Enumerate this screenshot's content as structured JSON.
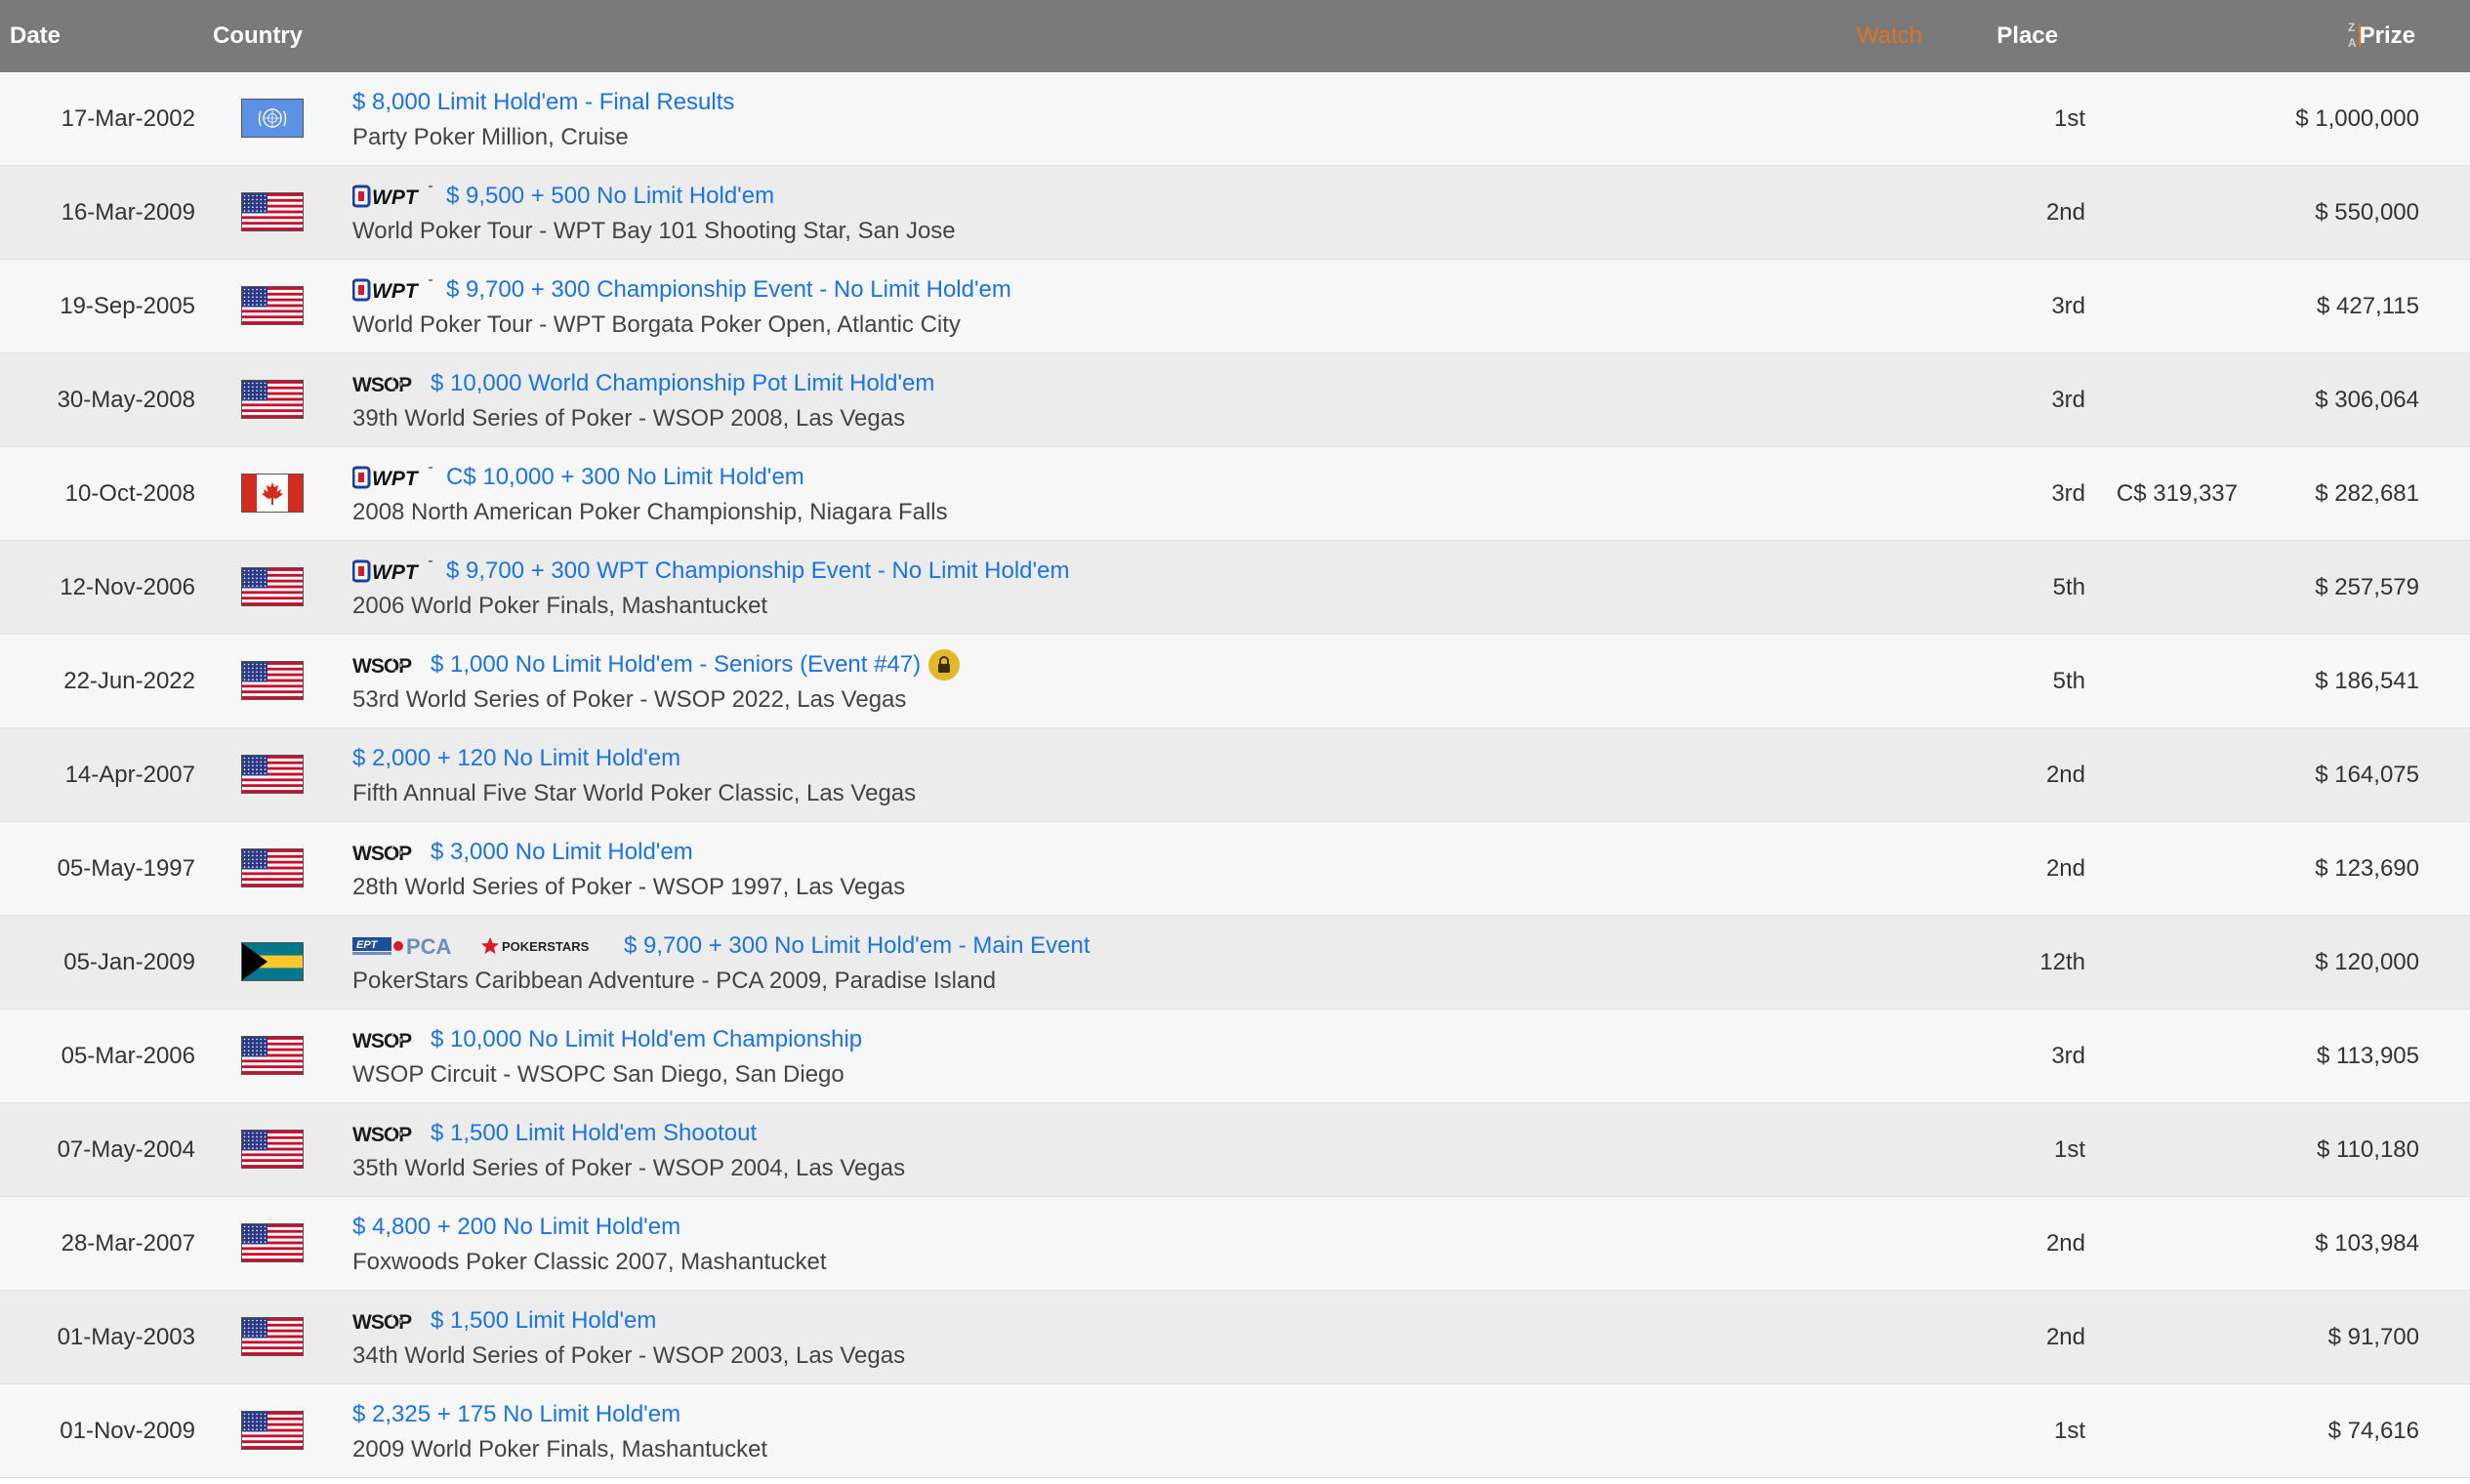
{
  "header": {
    "date": "Date",
    "country": "Country",
    "watch": "Watch",
    "place": "Place",
    "sort_icon": "sort-z-a-icon",
    "prize": "Prize"
  },
  "colors": {
    "header_bg": "#7a7a7a",
    "watch": "#e0731f",
    "link": "#1a73e8",
    "row_odd": "#f7f7f7",
    "row_even": "#ececec",
    "lock": "#e5b82a"
  },
  "rows": [
    {
      "date": "17-Mar-2002",
      "country": "un-flag",
      "logos": [],
      "title": "$ 8,000 Limit Hold'em - Final Results",
      "subtitle": "Party Poker Million, Cruise",
      "lock": false,
      "place": "1st",
      "local_prize": "",
      "prize": "$ 1,000,000"
    },
    {
      "date": "16-Mar-2009",
      "country": "us-flag",
      "logos": [
        "wpt-logo"
      ],
      "title": "$ 9,500 + 500 No Limit Hold'em",
      "subtitle": "World Poker Tour - WPT Bay 101 Shooting Star, San Jose",
      "lock": false,
      "place": "2nd",
      "local_prize": "",
      "prize": "$ 550,000"
    },
    {
      "date": "19-Sep-2005",
      "country": "us-flag",
      "logos": [
        "wpt-logo"
      ],
      "title": "$ 9,700 + 300 Championship Event - No Limit Hold'em",
      "subtitle": "World Poker Tour - WPT Borgata Poker Open, Atlantic City",
      "lock": false,
      "place": "3rd",
      "local_prize": "",
      "prize": "$ 427,115"
    },
    {
      "date": "30-May-2008",
      "country": "us-flag",
      "logos": [
        "wsop-logo"
      ],
      "title": "$ 10,000 World Championship Pot Limit Hold'em",
      "subtitle": "39th World Series of Poker - WSOP 2008, Las Vegas",
      "lock": false,
      "place": "3rd",
      "local_prize": "",
      "prize": "$ 306,064"
    },
    {
      "date": "10-Oct-2008",
      "country": "ca-flag",
      "logos": [
        "wpt-logo"
      ],
      "title": "C$ 10,000 + 300 No Limit Hold'em",
      "subtitle": "2008 North American Poker Championship, Niagara Falls",
      "lock": false,
      "place": "3rd",
      "local_prize": "C$ 319,337",
      "prize": "$ 282,681"
    },
    {
      "date": "12-Nov-2006",
      "country": "us-flag",
      "logos": [
        "wpt-logo"
      ],
      "title": "$ 9,700 + 300 WPT Championship Event - No Limit Hold'em",
      "subtitle": "2006 World Poker Finals, Mashantucket",
      "lock": false,
      "place": "5th",
      "local_prize": "",
      "prize": "$ 257,579"
    },
    {
      "date": "22-Jun-2022",
      "country": "us-flag",
      "logos": [
        "wsop-logo"
      ],
      "title": "$ 1,000 No Limit Hold'em - Seniors (Event #47)",
      "subtitle": "53rd World Series of Poker - WSOP 2022, Las Vegas",
      "lock": true,
      "place": "5th",
      "local_prize": "",
      "prize": "$ 186,541"
    },
    {
      "date": "14-Apr-2007",
      "country": "us-flag",
      "logos": [],
      "title": "$ 2,000 + 120 No Limit Hold'em",
      "subtitle": "Fifth Annual Five Star World Poker Classic, Las Vegas",
      "lock": false,
      "place": "2nd",
      "local_prize": "",
      "prize": "$ 164,075"
    },
    {
      "date": "05-May-1997",
      "country": "us-flag",
      "logos": [
        "wsop-logo"
      ],
      "title": "$ 3,000 No Limit Hold'em",
      "subtitle": "28th World Series of Poker - WSOP 1997, Las Vegas",
      "lock": false,
      "place": "2nd",
      "local_prize": "",
      "prize": "$ 123,690"
    },
    {
      "date": "05-Jan-2009",
      "country": "bs-flag",
      "logos": [
        "ept-pca-logo",
        "pokerstars-logo"
      ],
      "title": "$ 9,700 + 300 No Limit Hold'em - Main Event",
      "subtitle": "PokerStars Caribbean Adventure - PCA 2009, Paradise Island",
      "lock": false,
      "place": "12th",
      "local_prize": "",
      "prize": "$ 120,000"
    },
    {
      "date": "05-Mar-2006",
      "country": "us-flag",
      "logos": [
        "wsop-logo"
      ],
      "title": "$ 10,000 No Limit Hold'em Championship",
      "subtitle": "WSOP Circuit - WSOPC San Diego, San Diego",
      "lock": false,
      "place": "3rd",
      "local_prize": "",
      "prize": "$ 113,905"
    },
    {
      "date": "07-May-2004",
      "country": "us-flag",
      "logos": [
        "wsop-logo"
      ],
      "title": "$ 1,500 Limit Hold'em Shootout",
      "subtitle": "35th World Series of Poker - WSOP 2004, Las Vegas",
      "lock": false,
      "place": "1st",
      "local_prize": "",
      "prize": "$ 110,180"
    },
    {
      "date": "28-Mar-2007",
      "country": "us-flag",
      "logos": [],
      "title": "$ 4,800 + 200 No Limit Hold'em",
      "subtitle": "Foxwoods Poker Classic 2007, Mashantucket",
      "lock": false,
      "place": "2nd",
      "local_prize": "",
      "prize": "$ 103,984"
    },
    {
      "date": "01-May-2003",
      "country": "us-flag",
      "logos": [
        "wsop-logo"
      ],
      "title": "$ 1,500 Limit Hold'em",
      "subtitle": "34th World Series of Poker - WSOP 2003, Las Vegas",
      "lock": false,
      "place": "2nd",
      "local_prize": "",
      "prize": "$ 91,700"
    },
    {
      "date": "01-Nov-2009",
      "country": "us-flag",
      "logos": [],
      "title": "$ 2,325 + 175 No Limit Hold'em",
      "subtitle": "2009 World Poker Finals, Mashantucket",
      "lock": false,
      "place": "1st",
      "local_prize": "",
      "prize": "$ 74,616"
    }
  ],
  "logo_text": {
    "wpt": "WPT",
    "wsop": "WSOP",
    "pca": "PCA",
    "ept": "EPT",
    "pokerstars": "POKERSTARS"
  }
}
